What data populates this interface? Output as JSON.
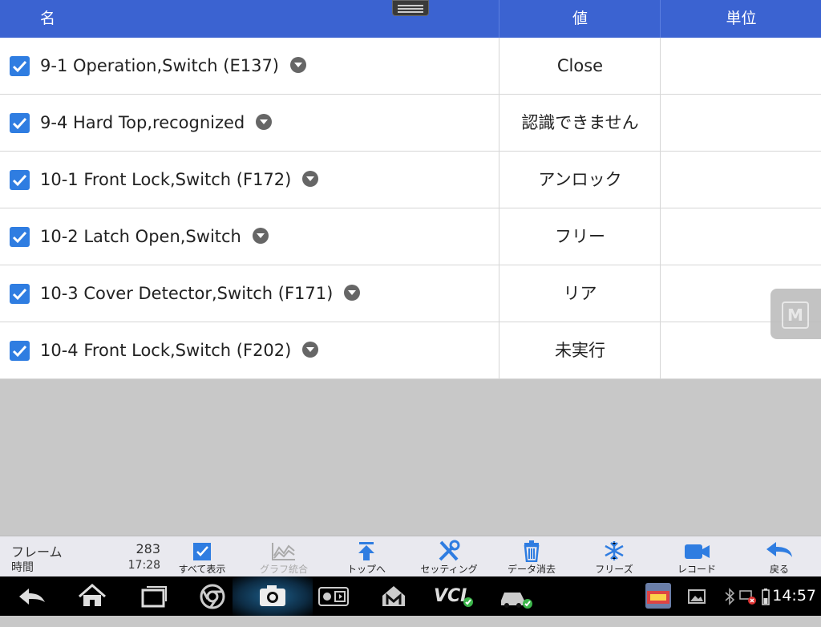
{
  "header": {
    "col_name": "名",
    "col_value": "値",
    "col_unit": "単位"
  },
  "rows": [
    {
      "name": "9-1 Operation,Switch (E137)",
      "value": "Close",
      "unit": "",
      "checked": true
    },
    {
      "name": "9-4 Hard Top,recognized",
      "value": "認識できません",
      "unit": "",
      "checked": true
    },
    {
      "name": "10-1 Front Lock,Switch (F172)",
      "value": "アンロック",
      "unit": "",
      "checked": true
    },
    {
      "name": "10-2 Latch Open,Switch",
      "value": "フリー",
      "unit": "",
      "checked": true
    },
    {
      "name": "10-3 Cover Detector,Switch (F171)",
      "value": "リア",
      "unit": "",
      "checked": true
    },
    {
      "name": "10-4 Front Lock,Switch (F202)",
      "value": "未実行",
      "unit": "",
      "checked": true
    }
  ],
  "floating_button": {
    "label": "M"
  },
  "toolbar": {
    "frame_label": "フレーム",
    "frame_value": "283",
    "time_label": "時間",
    "time_value": "17:28",
    "buttons": [
      {
        "label": "すべて表示",
        "icon": "checkbox-icon",
        "enabled": true
      },
      {
        "label": "グラフ統合",
        "icon": "graph-merge-icon",
        "enabled": false
      },
      {
        "label": "トップへ",
        "icon": "to-top-icon",
        "enabled": true
      },
      {
        "label": "セッティング",
        "icon": "tools-icon",
        "enabled": true
      },
      {
        "label": "データ消去",
        "icon": "trash-icon",
        "enabled": true
      },
      {
        "label": "フリーズ",
        "icon": "snowflake-icon",
        "enabled": true
      },
      {
        "label": "レコード",
        "icon": "video-camera-icon",
        "enabled": true
      },
      {
        "label": "戻る",
        "icon": "back-arrow-icon",
        "enabled": true
      }
    ]
  },
  "navbar": {
    "items": [
      "back-icon",
      "home-icon",
      "recent-apps-icon",
      "chrome-icon",
      "camera-icon",
      "brightness-icon",
      "maxisys-icon",
      "vci-icon",
      "car-icon"
    ],
    "vci_label": "VCI",
    "clock": "14:57"
  },
  "colors": {
    "header_bg": "#3b63d1",
    "accent": "#2f7de1",
    "check_bg": "#2f7de1"
  }
}
